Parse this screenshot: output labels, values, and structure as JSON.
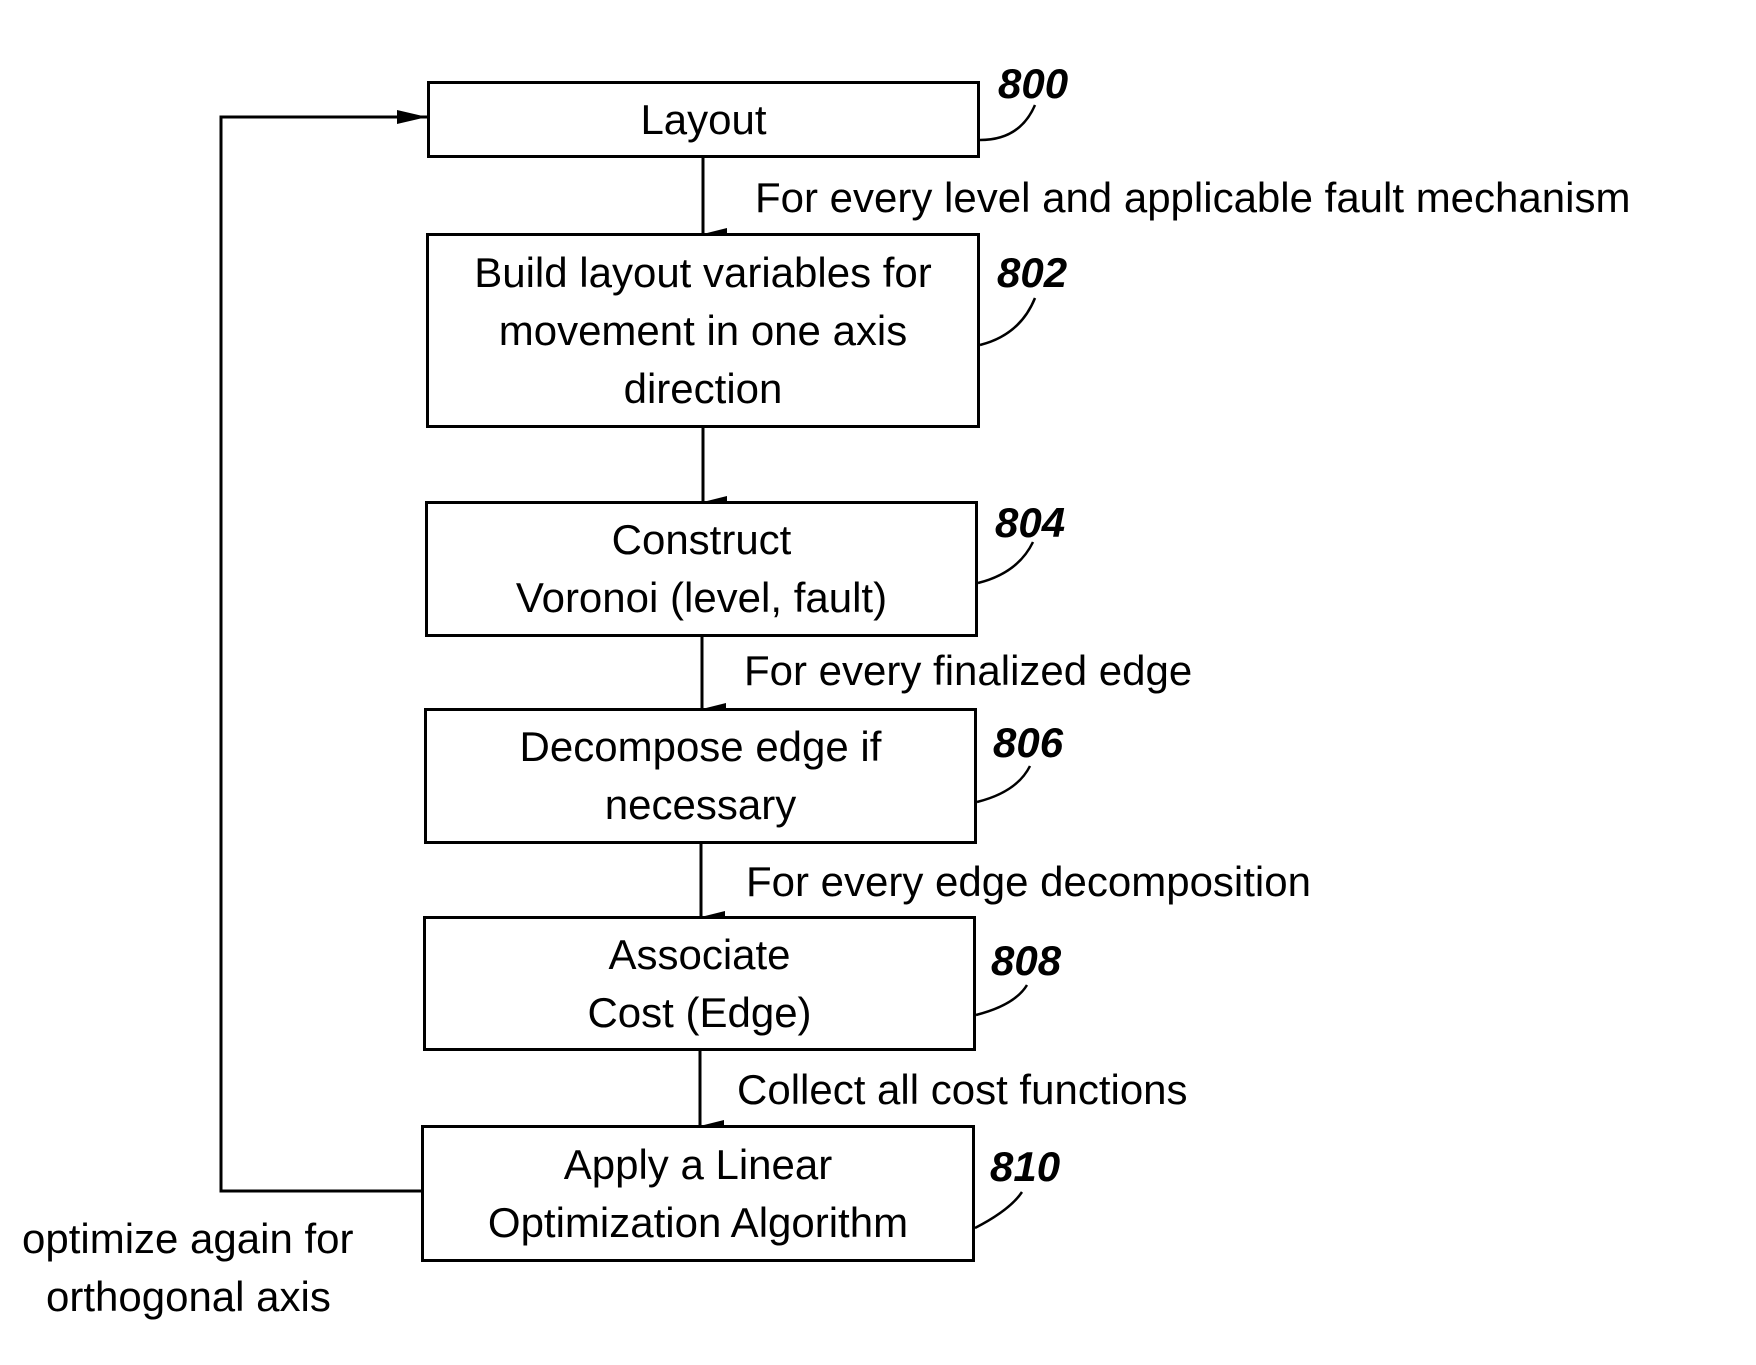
{
  "diagram": {
    "type": "flowchart",
    "steps": [
      {
        "id": "800",
        "lines": [
          "Layout"
        ]
      },
      {
        "id": "802",
        "lines": [
          "Build layout variables for",
          "movement in one axis",
          "direction"
        ]
      },
      {
        "id": "804",
        "lines": [
          "Construct",
          "Voronoi (level, fault)"
        ]
      },
      {
        "id": "806",
        "lines": [
          "Decompose edge if",
          "necessary"
        ]
      },
      {
        "id": "808",
        "lines": [
          "Associate",
          "Cost (Edge)"
        ]
      },
      {
        "id": "810",
        "lines": [
          "Apply a Linear",
          "Optimization Algorithm"
        ]
      }
    ],
    "edge_labels": [
      {
        "from": "800",
        "to": "802",
        "text": "For every level and applicable fault mechanism"
      },
      {
        "from": "804",
        "to": "806",
        "text": "For every finalized edge"
      },
      {
        "from": "806",
        "to": "808",
        "text": "For every edge decomposition"
      },
      {
        "from": "808",
        "to": "810",
        "text": "Collect all cost functions"
      }
    ],
    "loop": {
      "from": "810",
      "to": "800",
      "lines": [
        "optimize again for",
        "orthogonal axis"
      ]
    }
  }
}
